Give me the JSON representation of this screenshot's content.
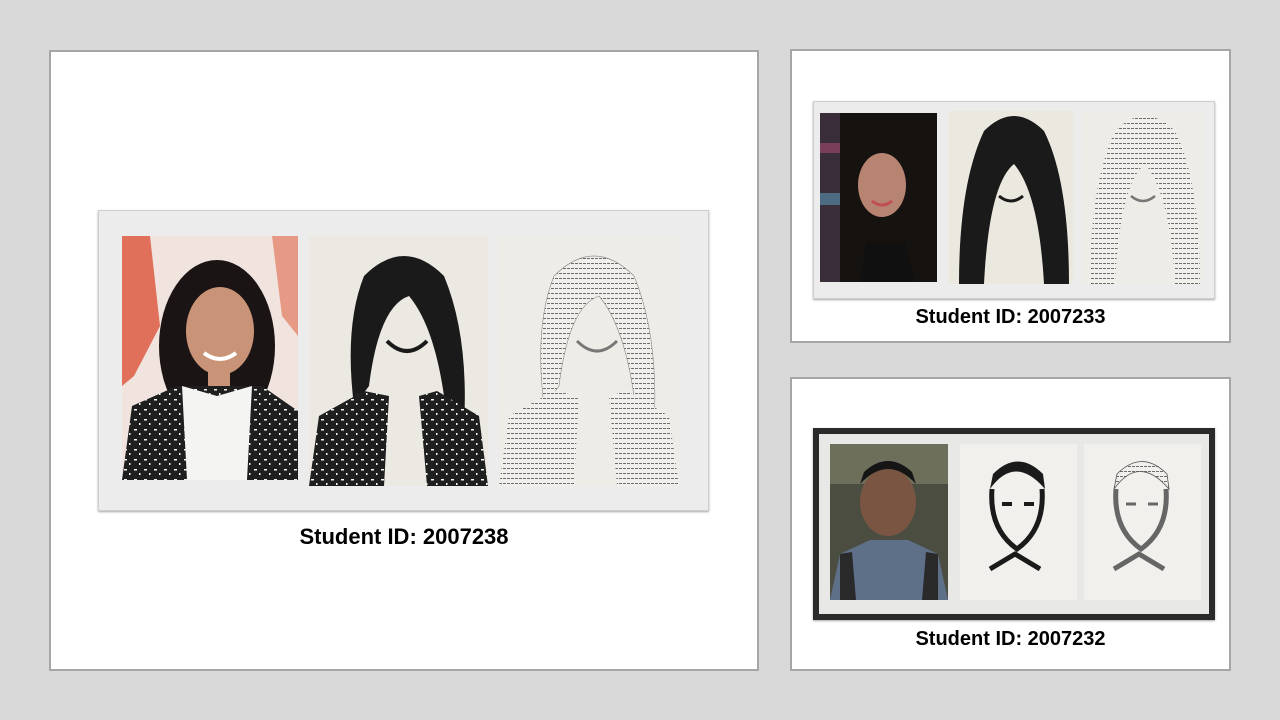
{
  "slide": {
    "background": "#d9d9d9",
    "cards": [
      {
        "id": "2007238",
        "caption": "Student ID: 2007238",
        "panels": [
          "color-photo",
          "stencil-portrait",
          "text-art-portrait"
        ]
      },
      {
        "id": "2007233",
        "caption": "Student ID: 2007233",
        "panels": [
          "color-photo",
          "stencil-portrait",
          "text-art-portrait"
        ]
      },
      {
        "id": "2007232",
        "caption": "Student ID: 2007232",
        "panels": [
          "color-photo",
          "stencil-portrait",
          "text-art-portrait"
        ]
      }
    ]
  },
  "colors": {
    "card_border": "#a6a6a6",
    "frame": "#ececec",
    "ink": "#1a1a1a",
    "paper": "#ece9e2"
  }
}
